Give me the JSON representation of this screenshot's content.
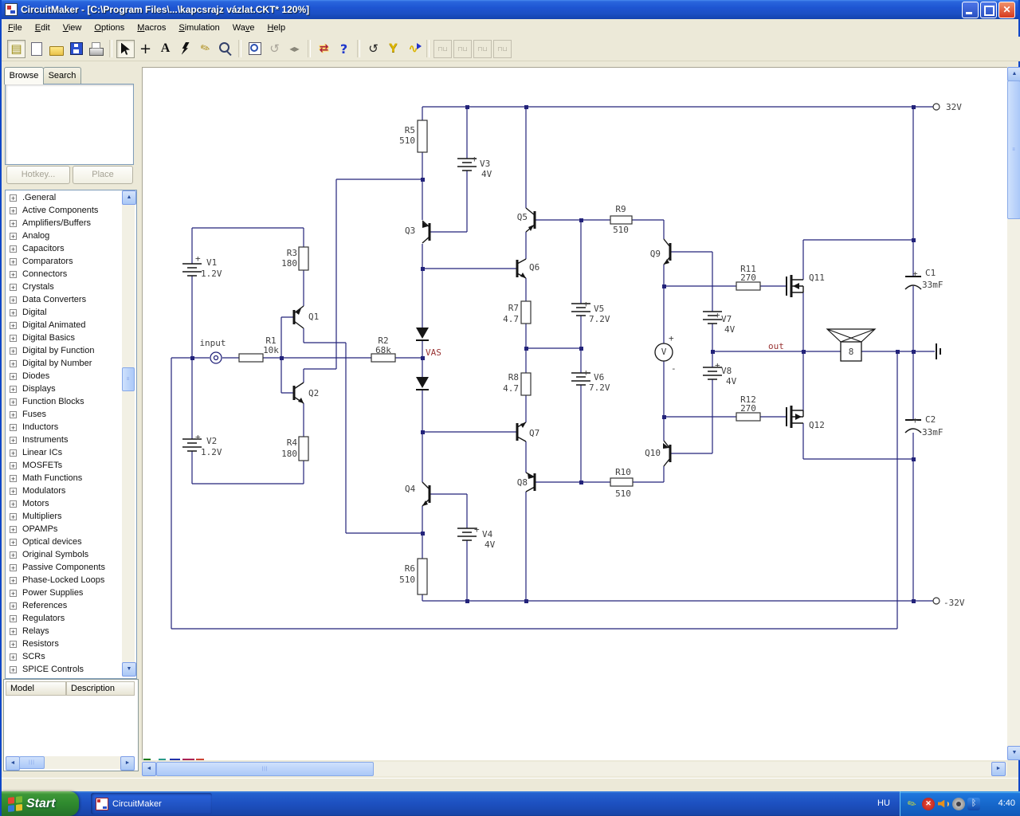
{
  "window": {
    "title": "CircuitMaker - [C:\\Program Files\\...\\kapcsrajz vázlat.CKT* 120%]"
  },
  "menu": {
    "items": [
      {
        "label": "File",
        "u": 0
      },
      {
        "label": "Edit",
        "u": 0
      },
      {
        "label": "View",
        "u": 0
      },
      {
        "label": "Options",
        "u": 0
      },
      {
        "label": "Macros",
        "u": 0
      },
      {
        "label": "Simulation",
        "u": 0
      },
      {
        "label": "Wave",
        "u": 2
      },
      {
        "label": "Help",
        "u": 0
      }
    ]
  },
  "toolbar": {
    "items": [
      "browse-panel",
      "new-file",
      "open-folder",
      "save",
      "print",
      "|",
      "cursor-tool",
      "wire-tool",
      "text-tool",
      "delete-tool",
      "probe-tool",
      "zoom-tool",
      "|",
      "zoom-window",
      "rotate",
      "mirror",
      "|",
      "simulation-setup",
      "help",
      "|",
      "reset",
      "options-wrench",
      "waveform-probe",
      "|",
      "scope-a",
      "scope-b",
      "scope-c",
      "scope-d"
    ],
    "pressed": [
      "browse-panel",
      "cursor-tool"
    ],
    "disabled": [
      "rotate",
      "mirror",
      "scope-a",
      "scope-b",
      "scope-c",
      "scope-d"
    ]
  },
  "sidebar": {
    "tabs": [
      {
        "label": "Browse"
      },
      {
        "label": "Search"
      }
    ],
    "hotkey_button": "Hotkey...",
    "place_button": "Place",
    "categories": [
      ".General",
      "Active Components",
      "Amplifiers/Buffers",
      "Analog",
      "Capacitors",
      "Comparators",
      "Connectors",
      "Crystals",
      "Data Converters",
      "Digital",
      "Digital Animated",
      "Digital Basics",
      "Digital by Function",
      "Digital by Number",
      "Diodes",
      "Displays",
      "Function Blocks",
      "Fuses",
      "Inductors",
      "Instruments",
      "Linear ICs",
      "MOSFETs",
      "Math Functions",
      "Modulators",
      "Motors",
      "Multipliers",
      "OPAMPs",
      "Optical devices",
      "Original Symbols",
      "Passive Components",
      "Phase-Locked Loops",
      "Power Supplies",
      "References",
      "Regulators",
      "Relays",
      "Resistors",
      "SCRs",
      "SPICE Controls"
    ],
    "model_table": {
      "columns": [
        "Model",
        "Description"
      ]
    }
  },
  "schematic": {
    "colors": {
      "wire": "#23237a",
      "symbol": "#151515",
      "net_label": "#993333",
      "label": "#3f3f3f"
    },
    "labels": [
      [
        "input",
        264,
        434,
        "m"
      ],
      [
        "R1",
        337,
        431,
        "m"
      ],
      [
        "10k",
        337,
        443,
        "m"
      ],
      [
        "R2",
        478,
        431,
        "m"
      ],
      [
        "68k",
        478,
        443,
        "m"
      ],
      [
        "VAS",
        531,
        446,
        "s",
        "#993333"
      ],
      [
        "out",
        961,
        438,
        "s",
        "#993333"
      ],
      [
        "+",
        242,
        328,
        "s"
      ],
      [
        "V1",
        256,
        333,
        "s"
      ],
      [
        "1.2V",
        249,
        347,
        "s"
      ],
      [
        "+",
        242,
        552,
        "s"
      ],
      [
        "V2",
        256,
        557,
        "s"
      ],
      [
        "1.2V",
        249,
        571,
        "s"
      ],
      [
        "R3",
        370,
        321,
        "e"
      ],
      [
        "180",
        370,
        334,
        "e"
      ],
      [
        "R4",
        370,
        559,
        "e"
      ],
      [
        "180",
        370,
        573,
        "e"
      ],
      [
        "Q1",
        384,
        401,
        "s"
      ],
      [
        "Q2",
        384,
        497,
        "s"
      ],
      [
        "R5",
        518,
        167,
        "e"
      ],
      [
        "510",
        518,
        180,
        "e"
      ],
      [
        "+",
        589,
        203,
        "s"
      ],
      [
        "V3",
        599,
        209,
        "s"
      ],
      [
        "4V",
        601,
        222,
        "s"
      ],
      [
        "Q3",
        505,
        293,
        "s"
      ],
      [
        "Q4",
        505,
        617,
        "s"
      ],
      [
        "+",
        592,
        668,
        "s"
      ],
      [
        "V4",
        602,
        674,
        "s"
      ],
      [
        "4V",
        605,
        687,
        "s"
      ],
      [
        "R6",
        518,
        717,
        "e"
      ],
      [
        "510",
        518,
        731,
        "e"
      ],
      [
        "Q5",
        659,
        276,
        "e"
      ],
      [
        "Q6",
        661,
        339,
        "s"
      ],
      [
        "R7",
        648,
        390,
        "e"
      ],
      [
        "4.7",
        648,
        404,
        "e"
      ],
      [
        "R8",
        648,
        477,
        "e"
      ],
      [
        "4.7",
        648,
        491,
        "e"
      ],
      [
        "+",
        729,
        385,
        "s"
      ],
      [
        "V5",
        742,
        391,
        "s"
      ],
      [
        "7.2V",
        736,
        404,
        "s"
      ],
      [
        "+",
        729,
        471,
        "s"
      ],
      [
        "V6",
        742,
        477,
        "s"
      ],
      [
        "7.2V",
        736,
        490,
        "s"
      ],
      [
        "Q7",
        661,
        547,
        "s"
      ],
      [
        "Q8",
        659,
        609,
        "e"
      ],
      [
        "R9",
        776,
        266,
        "m"
      ],
      [
        "510",
        776,
        292,
        "m"
      ],
      [
        "R10",
        779,
        596,
        "m"
      ],
      [
        "510",
        779,
        623,
        "m"
      ],
      [
        "Q9",
        826,
        322,
        "e"
      ],
      [
        "Q10",
        826,
        572,
        "e"
      ],
      [
        "+",
        836,
        428,
        "s"
      ],
      [
        "V",
        830,
        445,
        "m"
      ],
      [
        "-",
        839,
        466,
        "s"
      ],
      [
        "+",
        894,
        399,
        "s"
      ],
      [
        "V7",
        902,
        404,
        "s"
      ],
      [
        "4V",
        906,
        417,
        "s"
      ],
      [
        "+",
        894,
        462,
        "s"
      ],
      [
        "V8",
        902,
        469,
        "s"
      ],
      [
        "4V",
        908,
        482,
        "s"
      ],
      [
        "R11",
        936,
        341,
        "m"
      ],
      [
        "270",
        936,
        352,
        "m"
      ],
      [
        "R12",
        936,
        505,
        "m"
      ],
      [
        "270",
        936,
        516,
        "m"
      ],
      [
        "Q11",
        1012,
        352,
        "s"
      ],
      [
        "Q12",
        1012,
        537,
        "s"
      ],
      [
        "8",
        1065,
        445,
        "m"
      ],
      [
        "+",
        1142,
        347,
        "s"
      ],
      [
        "C1",
        1158,
        346,
        "s"
      ],
      [
        "33mF",
        1154,
        361,
        "s"
      ],
      [
        "+",
        1142,
        531,
        "s"
      ],
      [
        "C2",
        1158,
        530,
        "s"
      ],
      [
        "33mF",
        1154,
        546,
        "s"
      ],
      [
        "32V",
        1184,
        138,
        "s"
      ],
      [
        "-32V",
        1181,
        760,
        "s"
      ]
    ]
  },
  "taskbar": {
    "start_label": "Start",
    "tasks": [
      {
        "label": "CircuitMaker"
      }
    ],
    "tray": {
      "language": "HU",
      "time": "4:40",
      "icons": [
        "pen-tablet",
        "security-alert",
        "volume",
        "webcam",
        "bluetooth"
      ]
    }
  }
}
